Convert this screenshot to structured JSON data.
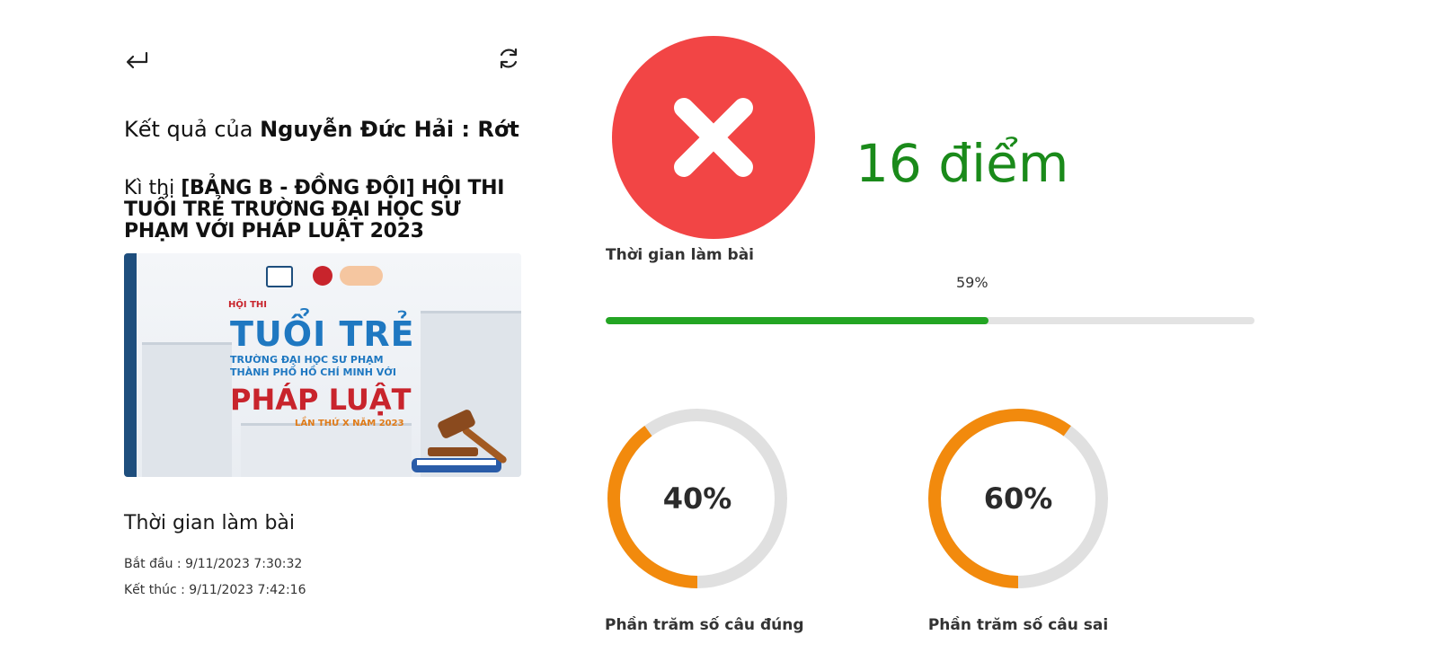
{
  "header": {
    "back_icon": "arrow-return-left-icon",
    "refresh_icon": "refresh-icon"
  },
  "result": {
    "prefix": "Kết quả của ",
    "candidate": "Nguyễn Đức Hải : Rớt"
  },
  "exam": {
    "prefix": "Kì thị ",
    "name": "[BẢNG B - ĐỒNG ĐỘI] HỘI THI TUỔI TRẺ TRƯỜNG ĐẠI HỌC SƯ PHẠM VỚI PHÁP LUẬT 2023"
  },
  "banner": {
    "hoithi": "HỘI THI",
    "tuoitre": "TUỔI TRẺ",
    "school_line1": "TRƯỜNG ĐẠI HỌC SƯ PHẠM",
    "school_line2": "THÀNH PHỐ HỒ CHÍ MINH VỚI",
    "phapluat": "PHÁP LUẬT",
    "lanthu": "LẦN THỨ X NĂM 2023"
  },
  "time": {
    "title": "Thời gian làm bài",
    "start": "Bắt đầu : 9/11/2023 7:30:32",
    "end": "Kết thúc : 9/11/2023 7:42:16"
  },
  "status": {
    "icon": "x-circle-icon",
    "color": "#f24545"
  },
  "score": {
    "text": "16 điểm",
    "color": "#1a8a1a"
  },
  "duration": {
    "label": "Thời gian làm bài",
    "percent_text": "59%",
    "fraction": 0.59,
    "fill_color": "#23a523"
  },
  "stats": {
    "correct": {
      "percent_text": "40%",
      "fraction": 0.4,
      "caption": "Phần trăm số câu đúng"
    },
    "wrong": {
      "percent_text": "60%",
      "fraction": 0.6,
      "caption": "Phần trăm số câu sai"
    },
    "ring_color": "#f28a0d",
    "track_color": "#e0e0e0"
  }
}
